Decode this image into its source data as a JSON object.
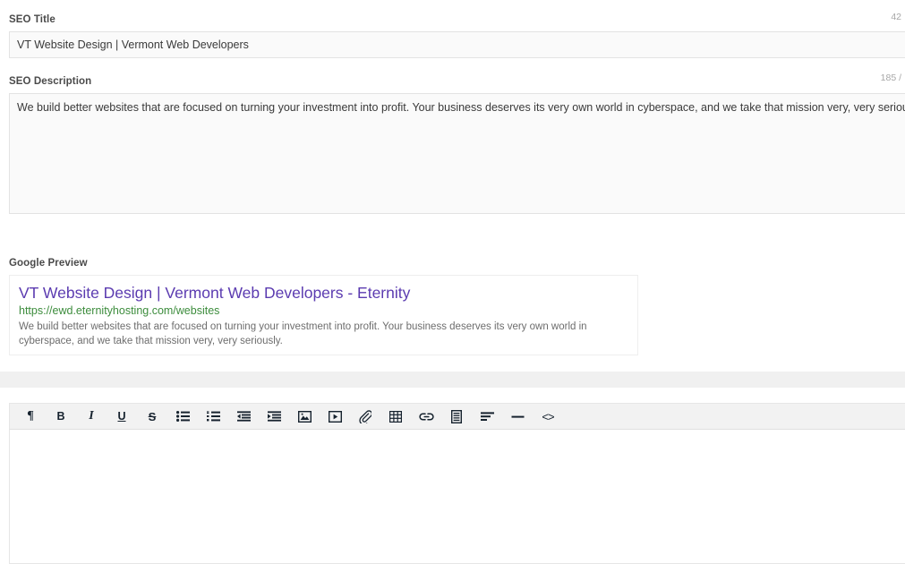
{
  "seo_title": {
    "label": "SEO Title",
    "value": "VT Website Design | Vermont Web Developers",
    "placeholder": "",
    "counter": "42"
  },
  "seo_description": {
    "label": "SEO Description",
    "value": "We build better websites that are focused on turning your investment into profit. Your business deserves its very own world in cyberspace, and we take that mission very, very seriously.",
    "placeholder": "",
    "counter": "185 /"
  },
  "google_preview": {
    "label": "Google Preview",
    "title": "VT Website Design | Vermont Web Developers - Eternity",
    "url": "https://ewd.eternityhosting.com/websites",
    "description": "We build better websites that are focused on turning your investment into profit. Your business deserves its very own world in cyberspace, and we take that mission very, very seriously.",
    "title_color": "#5b3bb0",
    "url_color": "#3c8c3c",
    "description_color": "#6d6d6d"
  },
  "editor": {
    "content": "",
    "toolbar": [
      {
        "name": "paragraph-icon",
        "label": "¶",
        "title": "Paragraph"
      },
      {
        "name": "bold-icon",
        "label": "B",
        "title": "Bold"
      },
      {
        "name": "italic-icon",
        "label": "I",
        "title": "Italic"
      },
      {
        "name": "underline-icon",
        "label": "U",
        "title": "Underline"
      },
      {
        "name": "strikethrough-icon",
        "label": "S",
        "title": "Strikethrough"
      },
      {
        "name": "unordered-list-icon",
        "label": "",
        "title": "Bulleted list"
      },
      {
        "name": "ordered-list-icon",
        "label": "",
        "title": "Numbered list"
      },
      {
        "name": "outdent-icon",
        "label": "",
        "title": "Decrease indent"
      },
      {
        "name": "indent-icon",
        "label": "",
        "title": "Increase indent"
      },
      {
        "name": "image-icon",
        "label": "",
        "title": "Insert image"
      },
      {
        "name": "video-icon",
        "label": "",
        "title": "Insert video"
      },
      {
        "name": "attachment-icon",
        "label": "",
        "title": "Attach file"
      },
      {
        "name": "table-icon",
        "label": "",
        "title": "Insert table"
      },
      {
        "name": "link-icon",
        "label": "",
        "title": "Insert link"
      },
      {
        "name": "blockquote-icon",
        "label": "",
        "title": "Blockquote"
      },
      {
        "name": "align-left-icon",
        "label": "",
        "title": "Align left"
      },
      {
        "name": "horizontal-rule-icon",
        "label": "",
        "title": "Horizontal rule"
      },
      {
        "name": "code-icon",
        "label": "<>",
        "title": "Source code"
      }
    ]
  },
  "colors": {
    "field_bg": "#fafafa",
    "field_border": "#e3e3e3",
    "toolbar_bg": "#f2f2f2",
    "band_bg": "#f0f0f0",
    "label_text": "#4a4a4a",
    "counter_text": "#a7a7a7"
  }
}
